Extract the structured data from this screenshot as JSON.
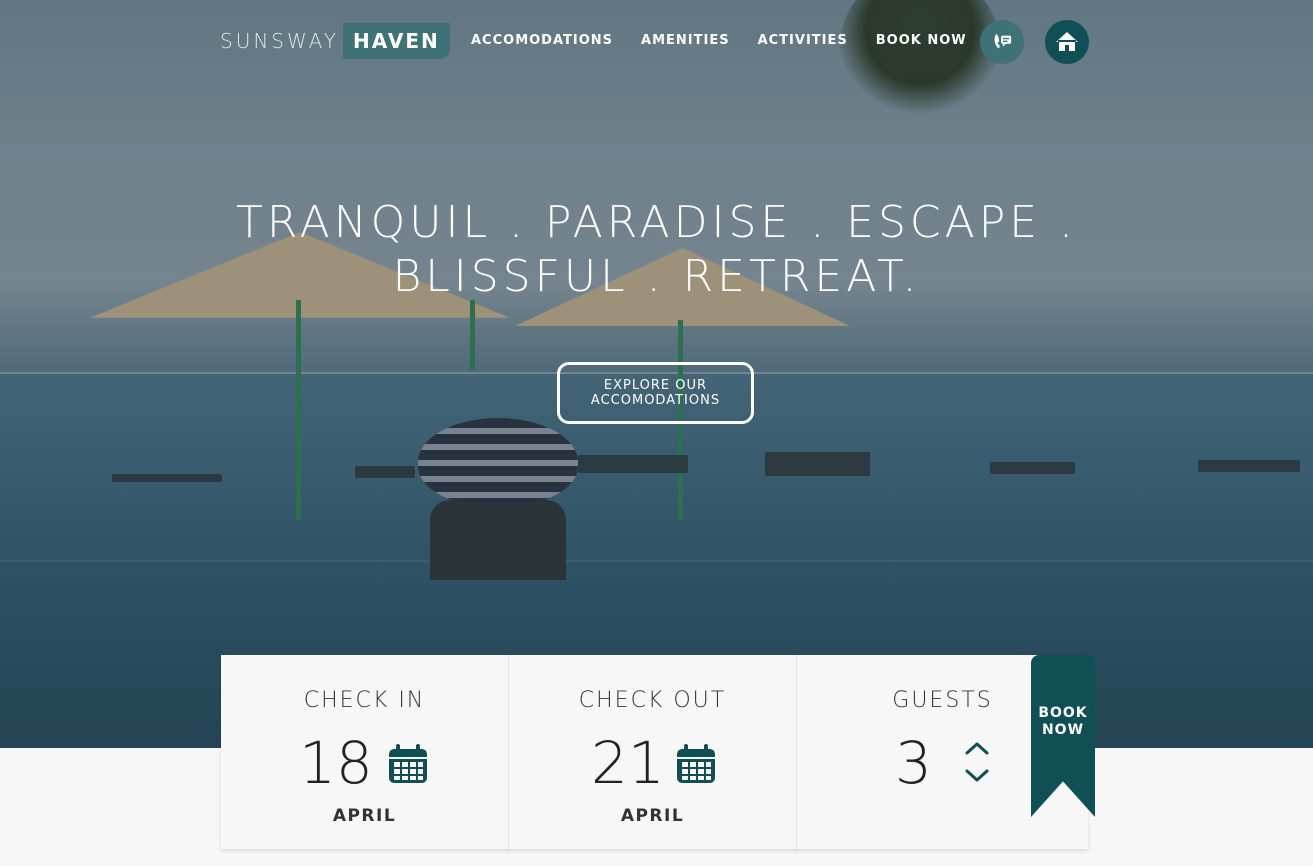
{
  "brand": {
    "light": "SUNSWAY",
    "box": "HAVEN",
    "accent": "#3f7277",
    "dark_accent": "#114f57"
  },
  "nav": {
    "items": [
      "ACCOMODATIONS",
      "AMENITIES",
      "ACTIVITIES",
      "BOOK NOW"
    ]
  },
  "icons": {
    "contact": "phone-chat-icon",
    "home": "home-icon"
  },
  "hero": {
    "line1": "TRANQUIL . PARADISE . ESCAPE .",
    "line2": "BLISSFUL . RETREAT.",
    "cta_line1": "EXPLORE OUR",
    "cta_line2": "ACCOMODATIONS"
  },
  "booking": {
    "check_in": {
      "label": "CHECK IN",
      "day": "18",
      "month": "APRIL"
    },
    "check_out": {
      "label": "CHECK OUT",
      "day": "21",
      "month": "APRIL"
    },
    "guests": {
      "label": "GUESTS",
      "count": "3"
    },
    "book_line1": "BOOK",
    "book_line2": "NOW"
  }
}
